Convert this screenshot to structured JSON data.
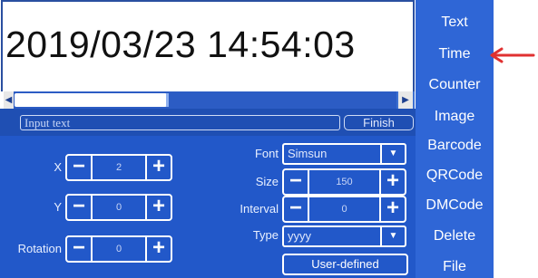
{
  "preview": {
    "text": "2019/03/23 14:54:03"
  },
  "input": {
    "placeholder": "Input text",
    "finish_label": "Finish"
  },
  "spinners": {
    "x": {
      "label": "X",
      "value": "2"
    },
    "y": {
      "label": "Y",
      "value": "0"
    },
    "rotation": {
      "label": "Rotation",
      "value": "0"
    },
    "size": {
      "label": "Size",
      "value": "150"
    },
    "interval": {
      "label": "Interval",
      "value": "0"
    }
  },
  "dropdowns": {
    "font": {
      "label": "Font",
      "value": "Simsun"
    },
    "type": {
      "label": "Type",
      "value": "yyyy"
    }
  },
  "user_defined_label": "User-defined",
  "menu": [
    "Text",
    "Time",
    "Counter",
    "Image",
    "Barcode",
    "QRCode",
    "DMCode",
    "Delete",
    "File"
  ],
  "colors": {
    "panel": "#2258c9",
    "menu": "#2f66d6",
    "annotation_arrow": "#e03131"
  },
  "icons": {
    "minus": "−",
    "plus": "+",
    "dropdown": "▼",
    "scroll_left": "◀",
    "scroll_right": "▶"
  }
}
